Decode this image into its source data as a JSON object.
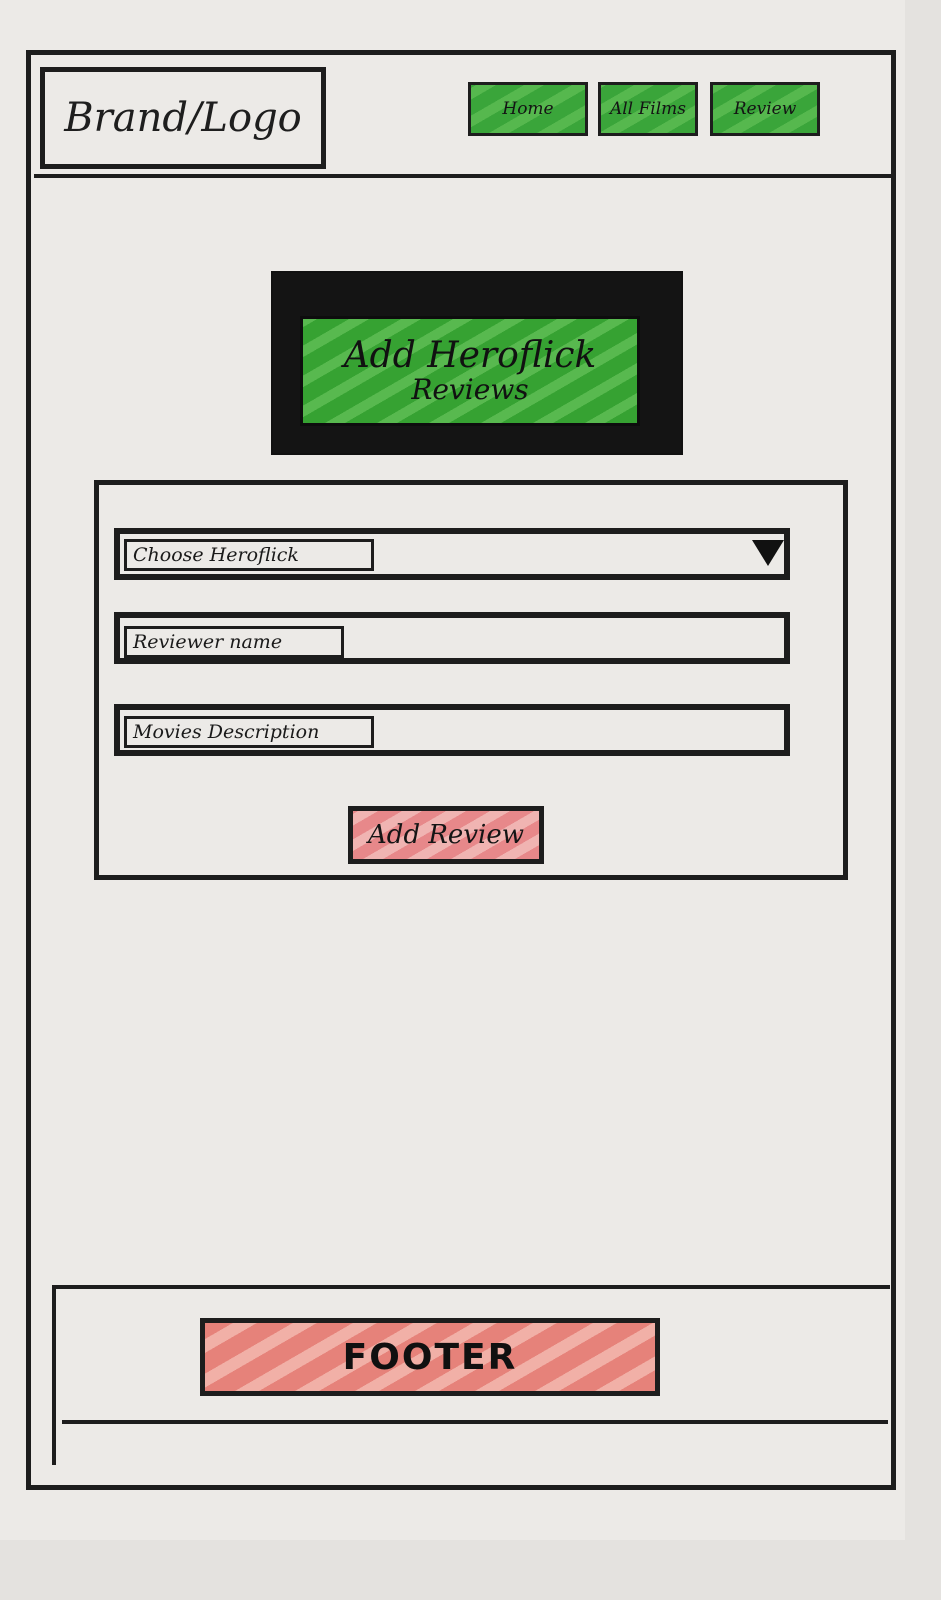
{
  "header": {
    "logo_text": "Brand/Logo",
    "nav": [
      {
        "label": "Home"
      },
      {
        "label": "All Films"
      },
      {
        "label": "Review"
      }
    ]
  },
  "hero": {
    "line1": "Add Heroflick",
    "line2": "Reviews"
  },
  "form": {
    "select_label": "Choose Heroflick",
    "name_label": "Reviewer name",
    "description_label": "Movies Description",
    "submit_label": "Add Review"
  },
  "footer": {
    "text": "FOOTER"
  },
  "colors": {
    "ink": "#1d1d1d",
    "nav_green": "#3aa53a",
    "submit_red": "#e7888a",
    "footer_red": "#e6827a",
    "paper": "#eceae7"
  }
}
